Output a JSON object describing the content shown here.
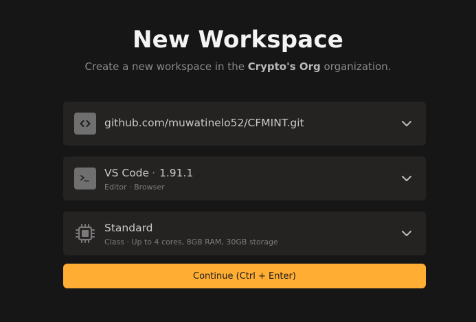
{
  "header": {
    "title": "New Workspace",
    "subtitle_prefix": "Create a new workspace in the ",
    "org_name": "Crypto's Org",
    "subtitle_suffix": " organization."
  },
  "repository": {
    "url": "github.com/muwatinelo52/CFMINT.git",
    "icon": "code-icon"
  },
  "editor": {
    "name": "VS Code",
    "version": "1.91.1",
    "label": "Editor",
    "type": "Browser",
    "icon": "terminal-icon"
  },
  "machine_class": {
    "name": "Standard",
    "label": "Class",
    "description": "Up to 4 cores, 8GB RAM, 30GB storage",
    "icon": "cpu-icon"
  },
  "actions": {
    "continue_label": "Continue (Ctrl + Enter)"
  },
  "colors": {
    "background": "#161616",
    "card": "#252322",
    "accent": "#ffad33"
  }
}
